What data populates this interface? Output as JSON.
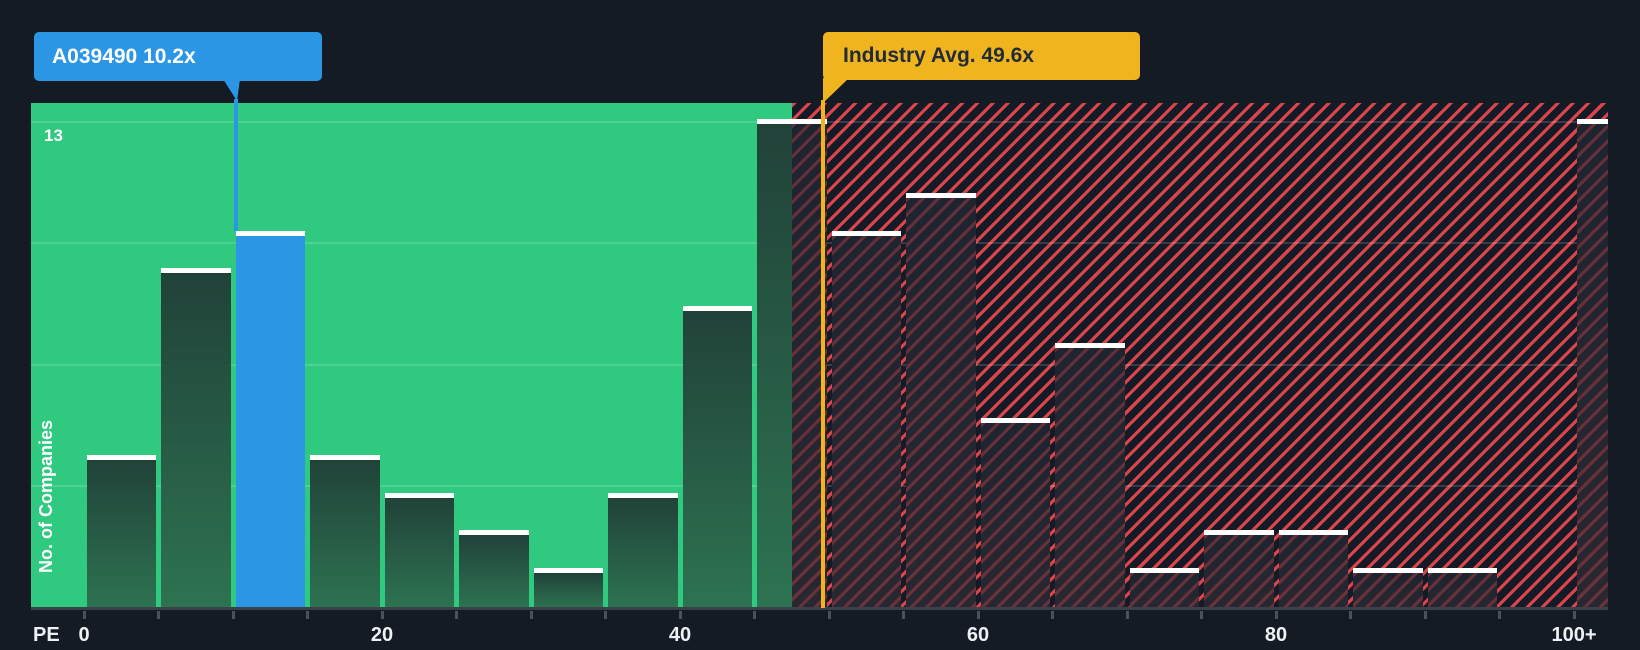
{
  "chart_data": {
    "type": "bar",
    "title": "Price to Earnings histogram vs industry",
    "xlabel": "PE",
    "ylabel": "No. of Companies",
    "y_max_label": "13",
    "ylim": [
      0,
      13.5
    ],
    "grid": "quarter horizontal gridlines, max count 13 labeled at top",
    "legend_position": "none",
    "x_axis_range_pe": [
      0,
      105
    ],
    "bin_size_pe": 5,
    "x_tick_labels": [
      {
        "pe": 0,
        "label": "0"
      },
      {
        "pe": 20,
        "label": "20"
      },
      {
        "pe": 40,
        "label": "40"
      },
      {
        "pe": 60,
        "label": "60"
      },
      {
        "pe": 80,
        "label": "80"
      },
      {
        "pe": 100,
        "label": "100+"
      }
    ],
    "bins": [
      {
        "range": "0-5",
        "count": 4,
        "zone": "green"
      },
      {
        "range": "5-10",
        "count": 9,
        "zone": "green"
      },
      {
        "range": "10-15",
        "count": 10,
        "zone": "green",
        "highlight": "company"
      },
      {
        "range": "15-20",
        "count": 4,
        "zone": "green"
      },
      {
        "range": "20-25",
        "count": 3,
        "zone": "green"
      },
      {
        "range": "25-30",
        "count": 2,
        "zone": "green"
      },
      {
        "range": "30-35",
        "count": 1,
        "zone": "green"
      },
      {
        "range": "35-40",
        "count": 3,
        "zone": "green"
      },
      {
        "range": "40-45",
        "count": 8,
        "zone": "green"
      },
      {
        "range": "45-50",
        "count": 13,
        "zone": "split"
      },
      {
        "range": "50-55",
        "count": 10,
        "zone": "red"
      },
      {
        "range": "55-60",
        "count": 11,
        "zone": "red"
      },
      {
        "range": "60-65",
        "count": 5,
        "zone": "red"
      },
      {
        "range": "65-70",
        "count": 7,
        "zone": "red"
      },
      {
        "range": "70-75",
        "count": 1,
        "zone": "red"
      },
      {
        "range": "75-80",
        "count": 2,
        "zone": "red"
      },
      {
        "range": "80-85",
        "count": 2,
        "zone": "red"
      },
      {
        "range": "85-90",
        "count": 1,
        "zone": "red"
      },
      {
        "range": "90-95",
        "count": 1,
        "zone": "red"
      },
      {
        "range": "95-100",
        "count": 0,
        "zone": "red"
      },
      {
        "range": "100+",
        "count": 13,
        "zone": "red"
      }
    ],
    "markers": {
      "company": {
        "label": "A039490 10.2x",
        "pe": 10.2,
        "color": "#2b96e4"
      },
      "industry": {
        "label": "Industry Avg. 49.6x",
        "pe": 49.6,
        "color": "#f0b41f"
      }
    },
    "zones": {
      "green_zone_max_pe": 47.5,
      "green_color": "#2fc980",
      "red_hatch_color": "#f2494f"
    }
  },
  "colors": {
    "background": "#141b25",
    "bar_top_stroke": "#ffffff",
    "axis_line": "#3a414b",
    "tick": "#4c525c",
    "axis_text": "#eef1f3"
  }
}
